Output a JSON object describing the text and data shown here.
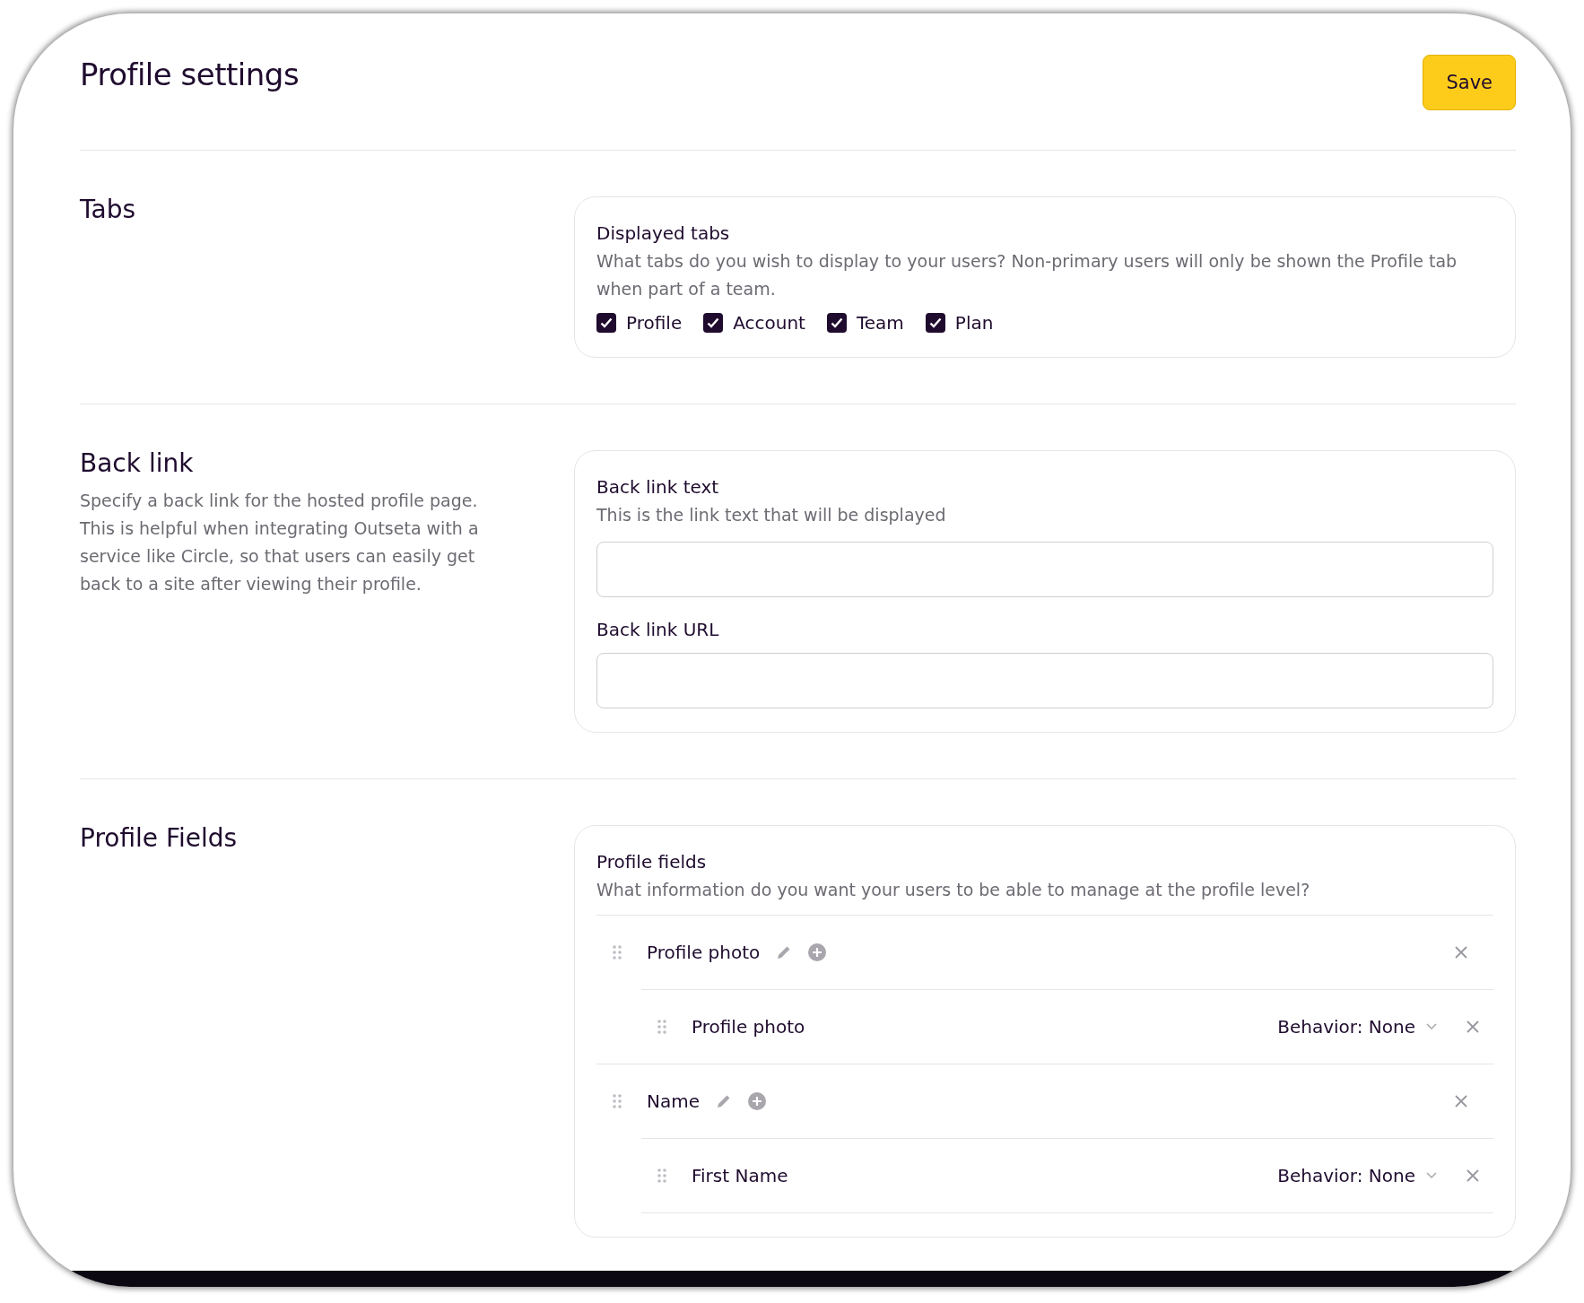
{
  "header": {
    "title": "Profile settings",
    "save_button": "Save"
  },
  "tabs_section": {
    "title": "Tabs",
    "card_title": "Displayed tabs",
    "card_description": "What tabs do you wish to display to your users? Non-primary users will only be shown the Profile tab when part of a team.",
    "options": [
      {
        "label": "Profile",
        "checked": true
      },
      {
        "label": "Account",
        "checked": true
      },
      {
        "label": "Team",
        "checked": true
      },
      {
        "label": "Plan",
        "checked": true
      }
    ]
  },
  "back_link_section": {
    "title": "Back link",
    "description": "Specify a back link for the hosted profile page. This is helpful when integrating Outseta with a service like Circle, so that users can easily get back to a site after viewing their profile.",
    "fields": [
      {
        "label": "Back link text",
        "hint": "This is the link text that will be displayed"
      },
      {
        "label": "Back link URL"
      }
    ]
  },
  "profile_fields_section": {
    "title": "Profile Fields",
    "card_title": "Profile fields",
    "card_description": "What information do you want your users to be able to manage at the profile level?",
    "fields": [
      {
        "label": "Profile photo",
        "children": [
          {
            "label": "Profile photo",
            "behavior": "Behavior: None"
          }
        ]
      },
      {
        "label": "Name",
        "children": [
          {
            "label": "First Name",
            "behavior": "Behavior: None"
          }
        ]
      }
    ]
  }
}
